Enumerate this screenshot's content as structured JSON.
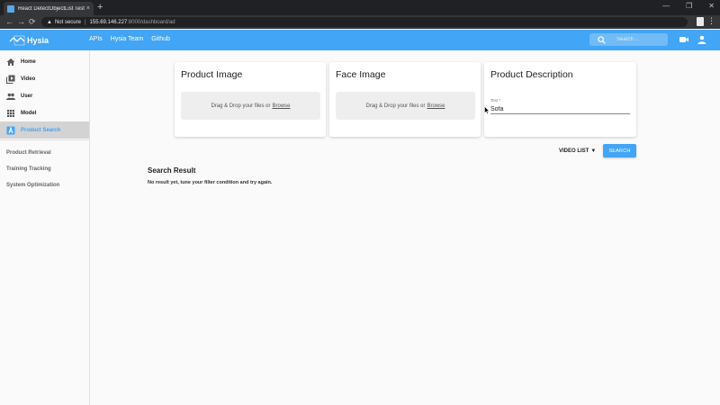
{
  "browser": {
    "tab_title": "React DetectObjectList Test",
    "tab_close": "×",
    "new_tab": "+",
    "window_controls": [
      "—",
      "❐",
      "✕"
    ],
    "nav": {
      "back": "←",
      "forward": "→",
      "reload": "⟳"
    },
    "address": {
      "security_label": "Not secure",
      "separator": "|",
      "host": "155.69.146.227",
      "path": ":8000/dashboard/ad"
    },
    "menu": "⋮"
  },
  "appbar": {
    "brand": "Hysia",
    "links": [
      "APIs",
      "Hysia Team",
      "Github"
    ],
    "search_placeholder": "Search…",
    "colors": {
      "primary": "#42a5f5"
    }
  },
  "sidebar": {
    "items": [
      {
        "label": "Home",
        "icon": "home-icon"
      },
      {
        "label": "Video",
        "icon": "video-library-icon"
      },
      {
        "label": "User",
        "icon": "people-icon"
      },
      {
        "label": "Model",
        "icon": "grid-icon"
      },
      {
        "label": "Product Search",
        "icon": "product-search-icon",
        "active": true
      }
    ],
    "sub_items": [
      "Product Retrieval",
      "Training Tracking",
      "System Optimization"
    ]
  },
  "main": {
    "cards": [
      {
        "title": "Product Image",
        "dropzone_text": "Drag & Drop your files or",
        "browse": "Browse"
      },
      {
        "title": "Face Image",
        "dropzone_text": "Drag & Drop your files or",
        "browse": "Browse"
      },
      {
        "title": "Product Description",
        "field_label": "Text *",
        "field_value": "Sofa"
      }
    ],
    "video_list_label": "VIDEO LIST",
    "caret": "▼",
    "search_button": "SEARCH",
    "result_title": "Search Result",
    "result_text": "No result yet, tune your filter condition and try again."
  }
}
